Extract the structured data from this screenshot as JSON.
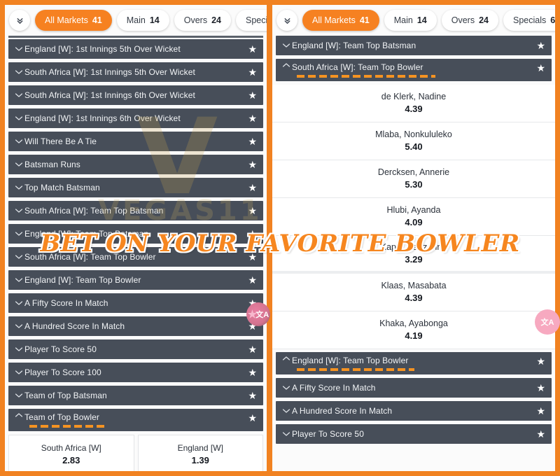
{
  "theme": {
    "accent": "#f18221",
    "row_bg": "#474e59",
    "active_tab_bg": "#f68121",
    "badge_pink": "#f7a9c0"
  },
  "banner": {
    "text": "BET ON YOUR FAVORITE BOWLER"
  },
  "watermark": {
    "mark": "V",
    "text": "VEGAS11"
  },
  "tabs": {
    "expand_icon": "chevron-double-down-icon",
    "items": [
      {
        "label": "All Markets",
        "count": "41",
        "active": true
      },
      {
        "label": "Main",
        "count": "14",
        "active": false
      },
      {
        "label": "Overs",
        "count": "24",
        "active": false
      },
      {
        "label": "Specials",
        "count": "6",
        "active": false
      }
    ]
  },
  "left_panel": {
    "markets": [
      {
        "label": "England [W]: 1st Innings 5th Over Wicket",
        "open": false
      },
      {
        "label": "South Africa [W]: 1st Innings 5th Over Wicket",
        "open": false
      },
      {
        "label": "South Africa [W]: 1st Innings 6th Over Wicket",
        "open": false
      },
      {
        "label": "England [W]: 1st Innings 6th Over Wicket",
        "open": false
      },
      {
        "label": "Will There Be A Tie",
        "open": false
      },
      {
        "label": "Batsman Runs",
        "open": false
      },
      {
        "label": "Top Match Batsman",
        "open": false
      },
      {
        "label": "South Africa [W]: Team Top Batsman",
        "open": false
      },
      {
        "label": "England [W]: Team Top Batsman",
        "open": false
      },
      {
        "label": "South Africa [W]: Team Top Bowler",
        "open": false
      },
      {
        "label": "England [W]: Team Top Bowler",
        "open": false
      },
      {
        "label": "A Fifty Score In Match",
        "open": false
      },
      {
        "label": "A Hundred Score In Match",
        "open": false
      },
      {
        "label": "Player To Score 50",
        "open": false
      },
      {
        "label": "Player To Score 100",
        "open": false
      },
      {
        "label": "Team of Top Batsman",
        "open": false
      },
      {
        "label": "Team of Top Bowler",
        "open": true
      }
    ],
    "team_odds": [
      {
        "name": "South Africa [W]",
        "odds": "2.83"
      },
      {
        "name": "England [W]",
        "odds": "1.39"
      }
    ]
  },
  "right_panel": {
    "markets_top": [
      {
        "label": "England [W]: Team Top Batsman",
        "open": false
      },
      {
        "label": "South Africa [W]: Team Top Bowler",
        "open": true
      }
    ],
    "players": [
      {
        "name": "de Klerk, Nadine",
        "odds": "4.39"
      },
      {
        "name": "Mlaba, Nonkululeko",
        "odds": "5.40"
      },
      {
        "name": "Dercksen, Annerie",
        "odds": "5.30"
      },
      {
        "name": "Hlubi, Ayanda",
        "odds": "4.09"
      },
      {
        "name": "Kapp, Marizanne",
        "odds": "3.29"
      },
      {
        "name": "Klaas, Masabata",
        "odds": "4.39"
      },
      {
        "name": "Khaka, Ayabonga",
        "odds": "4.19"
      }
    ],
    "markets_bottom": [
      {
        "label": "England [W]: Team Top Bowler",
        "open": true
      },
      {
        "label": "A Fifty Score In Match",
        "open": false
      },
      {
        "label": "A Hundred Score In Match",
        "open": false
      },
      {
        "label": "Player To Score 50",
        "open": false
      }
    ]
  },
  "badges": {
    "translate_label": "文A"
  }
}
